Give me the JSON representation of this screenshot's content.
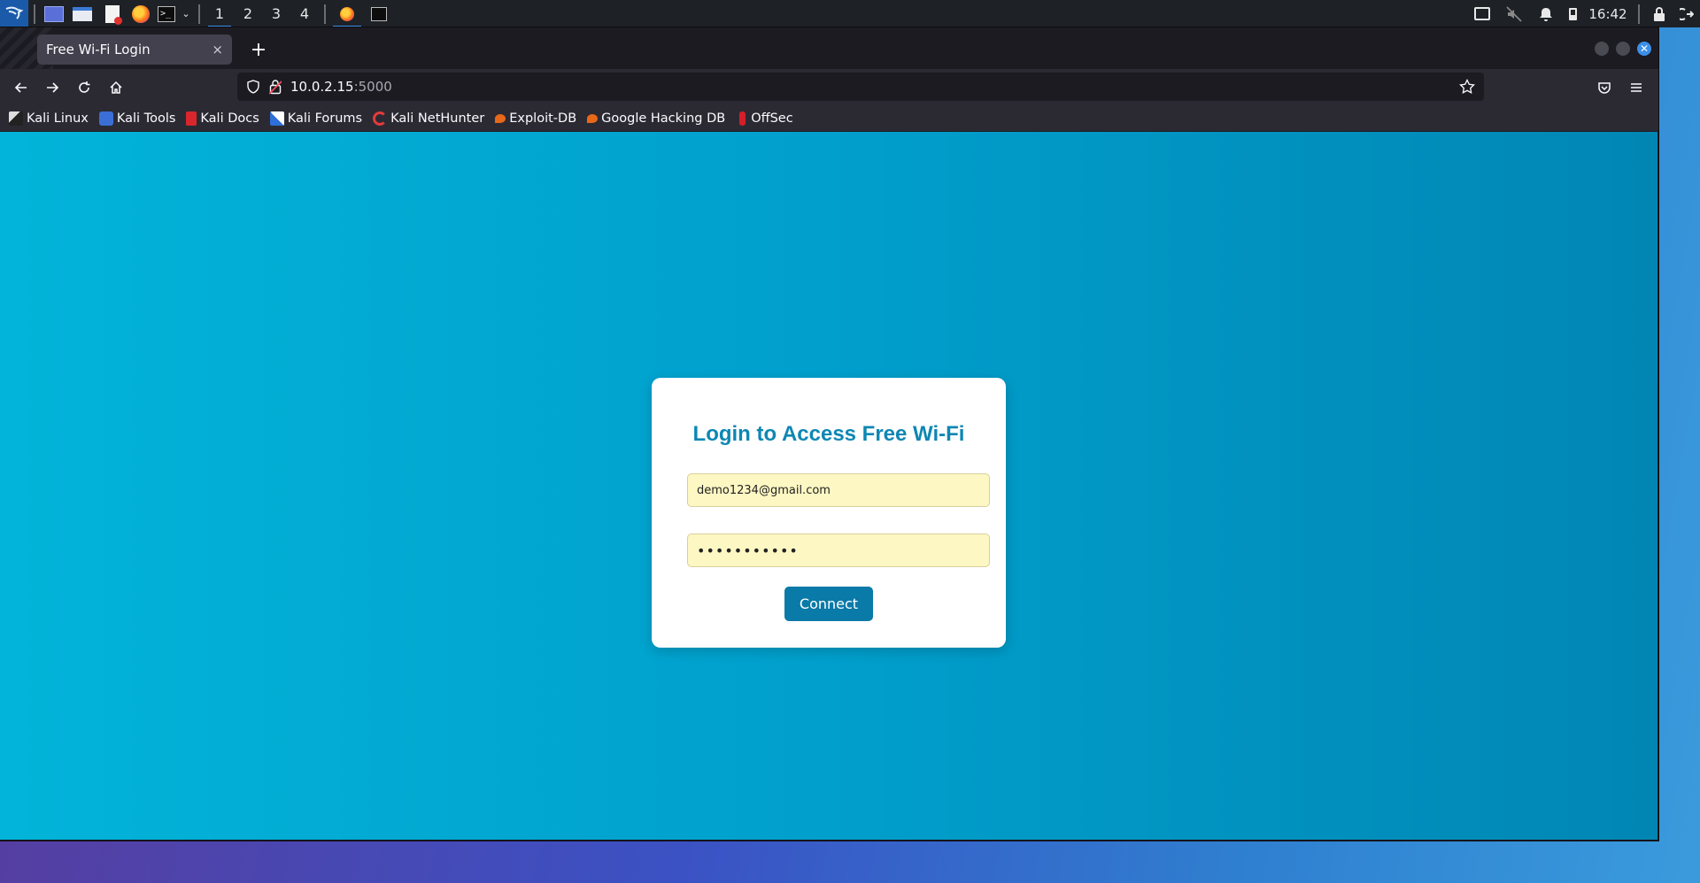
{
  "panel": {
    "workspaces": [
      "1",
      "2",
      "3",
      "4"
    ],
    "clock": "16:42"
  },
  "browser": {
    "tab_title": "Free Wi-Fi Login",
    "tab_close": "×",
    "new_tab": "+",
    "url_host": "10.0.2.15",
    "url_port": ":5000"
  },
  "bookmarks": [
    {
      "label": "Kali Linux"
    },
    {
      "label": "Kali Tools"
    },
    {
      "label": "Kali Docs"
    },
    {
      "label": "Kali Forums"
    },
    {
      "label": "Kali NetHunter"
    },
    {
      "label": "Exploit-DB"
    },
    {
      "label": "Google Hacking DB"
    },
    {
      "label": "OffSec"
    }
  ],
  "login": {
    "title": "Login to Access Free Wi-Fi",
    "email_value": "demo1234@gmail.com",
    "password_value": "•••••••••••",
    "connect_label": "Connect"
  },
  "colors": {
    "accent": "#0a7aa8",
    "title": "#0e87b3",
    "autofill": "#fdf7c3"
  }
}
